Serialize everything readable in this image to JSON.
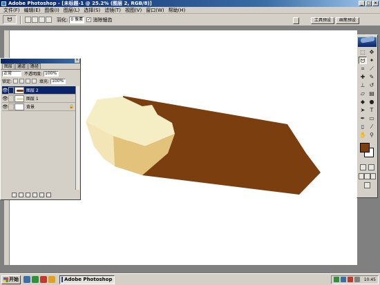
{
  "window": {
    "title": "Adobe Photoshop - [未标题-1 @ 25.2% (图层 2, RGB/8)]"
  },
  "menu": [
    "文件(F)",
    "编辑(E)",
    "图像(I)",
    "图层(L)",
    "选择(S)",
    "滤镜(T)",
    "视图(V)",
    "窗口(W)",
    "帮助(H)"
  ],
  "options": {
    "feather_label": "羽化:",
    "feather_value": "0 像素",
    "antialias_label": "消除锯齿",
    "tool_presets_tab": "工具预设",
    "brushes_tab": "画笔预设"
  },
  "layers_panel": {
    "tabs": [
      "图层",
      "通道",
      "路径"
    ],
    "blend_mode": "正常",
    "opacity_label": "不透明度:",
    "opacity_value": "100%",
    "lock_label": "锁定:",
    "fill_label": "填充:",
    "fill_value": "100%",
    "layers": [
      {
        "name": "图层 2",
        "selected": true,
        "thumb_color": "#7a3b0e"
      },
      {
        "name": "图层 1",
        "selected": false,
        "thumb_color": "#e6d5a0"
      },
      {
        "name": "背景",
        "selected": false,
        "thumb_color": "#ffffff"
      }
    ]
  },
  "colors": {
    "foreground": "#7b3f0f",
    "background": "#ffffff"
  },
  "taskbar": {
    "start_label": "开始",
    "task_label": "Adobe Photoshop - [...",
    "clock": "10:45"
  }
}
